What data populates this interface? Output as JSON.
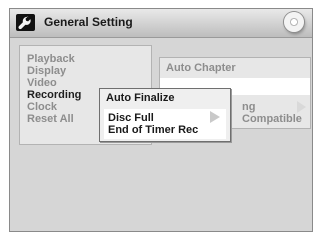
{
  "header": {
    "title": "General Setting",
    "left_icon": "wrench-icon",
    "right_icon": "disc-icon"
  },
  "menu": {
    "items": [
      "Playback",
      "Display",
      "Video",
      "Recording",
      "Clock",
      "Reset All"
    ],
    "selected": "Recording"
  },
  "submenu": {
    "items": [
      "Auto Chapter",
      "ng Compatible"
    ]
  },
  "popup": {
    "title": "Auto Finalize",
    "options": [
      "Disc Full",
      "End of Timer Rec"
    ],
    "selected": "Disc Full"
  },
  "colors": {
    "accent": "#1f1f1f",
    "inactive_text": "#8d8d8d",
    "panel_bg": "#e7e7e7",
    "screen_bg": "#d6d6d6"
  }
}
